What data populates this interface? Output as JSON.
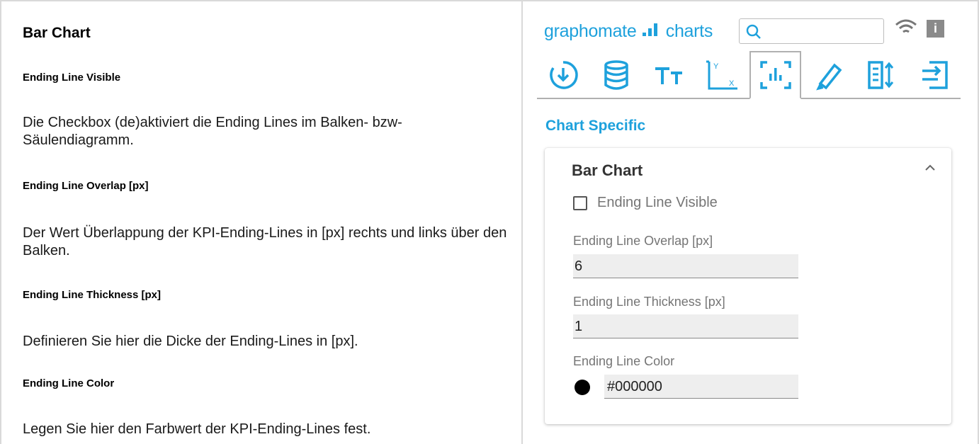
{
  "doc": {
    "title": "Bar Chart",
    "sections": [
      {
        "heading": "Ending Line Visible",
        "text": "Die Checkbox (de)aktiviert die Ending Lines im Balken- bzw- Säulendiagramm."
      },
      {
        "heading": "Ending Line Overlap [px]",
        "text": "Der Wert Überlappung der KPI-Ending-Lines in [px] rechts und links über den Balken."
      },
      {
        "heading": "Ending Line Thickness [px]",
        "text": "Definieren Sie hier die Dicke der Ending-Lines in [px]."
      },
      {
        "heading": "Ending Line Color",
        "text": "Legen Sie hier den Farbwert der KPI-Ending-Lines fest."
      }
    ]
  },
  "panel": {
    "logo_left": "graphomate",
    "logo_right": "charts",
    "search_value": "",
    "info_label": "i",
    "tabs": [
      {
        "icon": "load-icon"
      },
      {
        "icon": "database-icon"
      },
      {
        "icon": "text-icon"
      },
      {
        "icon": "axis-icon"
      },
      {
        "icon": "chart-specific-icon",
        "active": true
      },
      {
        "icon": "pencil-icon"
      },
      {
        "icon": "table-sort-icon"
      },
      {
        "icon": "export-icon"
      }
    ],
    "section_title": "Chart Specific",
    "card": {
      "title": "Bar Chart",
      "checkbox_label": "Ending Line Visible",
      "checkbox_checked": false,
      "overlap_label": "Ending Line Overlap [px]",
      "overlap_value": "6",
      "thickness_label": "Ending Line Thickness [px]",
      "thickness_value": "1",
      "color_label": "Ending Line Color",
      "color_value": "#000000"
    },
    "accent_color": "#1ea1dc"
  }
}
